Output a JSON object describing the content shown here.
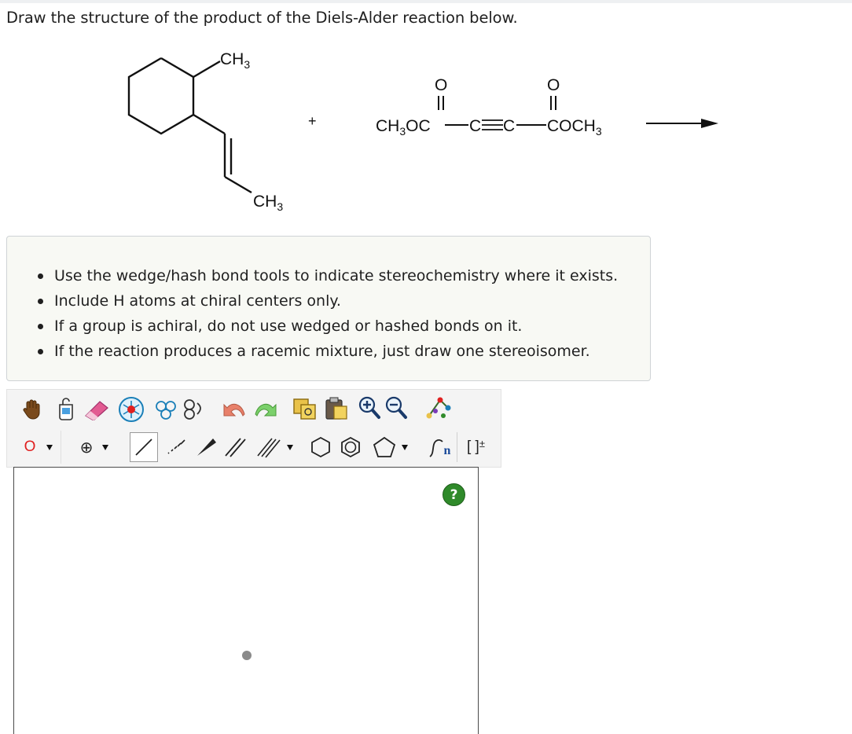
{
  "question": {
    "text": "Draw the structure of the product of the Diels-Alder reaction below."
  },
  "reaction": {
    "diene_ch3_top": "CH3",
    "diene_ch3_bottom": "CH3",
    "plus": "+",
    "dienophile_left": "CH3OC",
    "dienophile_middle": "C≡C",
    "dienophile_right": "COCH3",
    "oxygen": "O"
  },
  "instructions": [
    "Use the wedge/hash bond tools to indicate stereochemistry where it exists.",
    "Include H atoms at chiral centers only.",
    "If a group is achiral, do not use wedged or hashed bonds on it.",
    "If the reaction produces a racemic mixture, just draw one stereoisomer."
  ],
  "toolbar": {
    "atom_selector": "O",
    "charge_symbol": "⊕",
    "sgroup_label": "n",
    "bracket_label": "[ ]",
    "bracket_charge": "±",
    "help_label": "?"
  },
  "colors": {
    "help_green": "#2f8a2a",
    "atom_red": "#e02020",
    "eraser_pink": "#e25b92",
    "undo_red": "#e8806a",
    "redo_green": "#7bd06b"
  },
  "icons": [
    "hand-icon",
    "clear-canvas-icon",
    "eraser-icon",
    "ring-template-icon",
    "cleanup-icon",
    "undo-icon",
    "redo-icon",
    "copy-icon",
    "paste-icon",
    "zoom-in-icon",
    "zoom-out-icon",
    "atom-palette-icon"
  ]
}
